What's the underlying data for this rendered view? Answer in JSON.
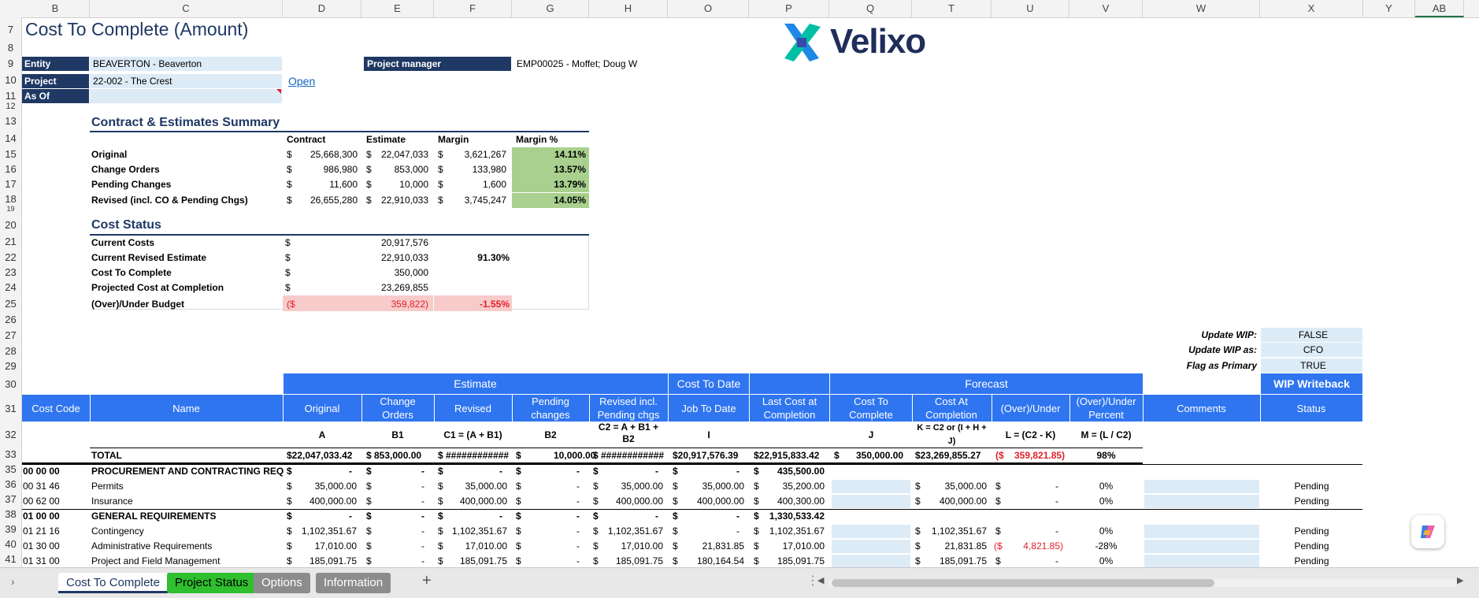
{
  "columns": [
    "B",
    "C",
    "D",
    "E",
    "F",
    "G",
    "H",
    "O",
    "P",
    "Q",
    "T",
    "U",
    "V",
    "W",
    "X",
    "Y",
    "AB"
  ],
  "rows": [
    "7",
    "8",
    "9",
    "10",
    "11",
    "12",
    "13",
    "14",
    "15",
    "16",
    "17",
    "18",
    "19",
    "20",
    "21",
    "22",
    "23",
    "24",
    "25",
    "26",
    "27",
    "28",
    "29",
    "30",
    "31",
    "32",
    "33",
    "35",
    "36",
    "37",
    "38",
    "39",
    "40",
    "41"
  ],
  "title": "Cost To Complete (Amount)",
  "logo_text": "Velixo",
  "header_fields": {
    "entity_label": "Entity",
    "entity_value": "BEAVERTON - Beaverton",
    "project_label": "Project",
    "project_value": "22-002 - The Crest",
    "asof_label": "As Of",
    "asof_value": "",
    "open_link": "Open",
    "pm_label": "Project manager",
    "pm_value": "EMP00025 - Moffet; Doug W"
  },
  "summary": {
    "title": "Contract & Estimates Summary",
    "headers": [
      "Contract",
      "Estimate",
      "Margin",
      "Margin %"
    ],
    "rows": [
      {
        "label": "Original",
        "contract": "25,668,300",
        "estimate": "22,047,033",
        "margin": "3,621,267",
        "pct": "14.11%"
      },
      {
        "label": "Change Orders",
        "contract": "986,980",
        "estimate": "853,000",
        "margin": "133,980",
        "pct": "13.57%"
      },
      {
        "label": "Pending Changes",
        "contract": "11,600",
        "estimate": "10,000",
        "margin": "1,600",
        "pct": "13.79%"
      },
      {
        "label": "Revised (incl. CO & Pending Chgs)",
        "contract": "26,655,280",
        "estimate": "22,910,033",
        "margin": "3,745,247",
        "pct": "14.05%"
      }
    ]
  },
  "cost_status": {
    "title": "Cost Status",
    "rows": [
      {
        "label": "Current Costs",
        "value": "20,917,576",
        "pct": ""
      },
      {
        "label": "Current Revised Estimate",
        "value": "22,910,033",
        "pct": "91.30%"
      },
      {
        "label": "Cost To Complete",
        "value": "350,000",
        "pct": ""
      },
      {
        "label": "Projected Cost at Completion",
        "value": "23,269,855",
        "pct": ""
      }
    ],
    "overunder_label": "(Over)/Under Budget",
    "overunder_value": "359,822)",
    "overunder_prefix": "($",
    "overunder_pct": "-1.55%"
  },
  "wip": {
    "update_label": "Update WIP:",
    "update_value": "FALSE",
    "as_label": "Update WIP as:",
    "as_value": "CFO",
    "primary_label": "Flag as Primary",
    "primary_value": "TRUE",
    "writeback": "WIP Writeback",
    "status": "Status"
  },
  "groups": {
    "estimate": "Estimate",
    "cost_to_date": "Cost To Date",
    "forecast": "Forecast"
  },
  "col_headers": {
    "cost_code": "Cost Code",
    "name": "Name",
    "original": "Original",
    "change_orders": "Change Orders",
    "revised": "Revised",
    "pending": "Pending changes",
    "revised_incl": "Revised incl. Pending chgs",
    "jtd": "Job To Date",
    "last_cost": "Last Cost at Completion",
    "ctc": "Cost To Complete",
    "cac": "Cost At Completion",
    "overunder": "(Over)/Under",
    "overunder_pct": "(Over)/Under Percent",
    "comments": "Comments"
  },
  "formulas": {
    "a": "A",
    "b1": "B1",
    "c1": "C1 = (A + B1)",
    "b2": "B2",
    "c2": "C2 = A + B1 + B2",
    "i": "I",
    "j": "J",
    "k": "K = C2 or (I + H + J)",
    "l": "L = (C2 - K)",
    "m": "M = (L / C2)"
  },
  "total": {
    "label": "TOTAL",
    "original": "$22,047,033.42",
    "change_orders": "$ 853,000.00",
    "revised": "$ ############",
    "pending": "$ 10,000.00",
    "revised_incl": "$ ############",
    "jtd": "$20,917,576.39",
    "last_cost": "$22,915,833.42",
    "ctc": "$ 350,000.00",
    "cac": "$23,269,855.27",
    "overunder": "($ 359,821.85)",
    "pct": "98%"
  },
  "lines": [
    {
      "code": "00 00 00",
      "name": "PROCUREMENT AND CONTRACTING REQ",
      "bold": true,
      "original": "-",
      "co": "-",
      "revised": "-",
      "pending": "-",
      "rincl": "-",
      "jtd": "-",
      "last": "435,500.00",
      "ctc": "",
      "cac": "",
      "ou": "",
      "pct": "",
      "status": ""
    },
    {
      "code": "00 31 46",
      "name": "Permits",
      "bold": false,
      "original": "35,000.00",
      "co": "-",
      "revised": "35,000.00",
      "pending": "-",
      "rincl": "35,000.00",
      "jtd": "35,000.00",
      "last": "35,200.00",
      "ctc": "",
      "cac": "35,000.00",
      "ou": "-",
      "pct": "0%",
      "status": "Pending"
    },
    {
      "code": "00 62 00",
      "name": "Insurance",
      "bold": false,
      "original": "400,000.00",
      "co": "-",
      "revised": "400,000.00",
      "pending": "-",
      "rincl": "400,000.00",
      "jtd": "400,000.00",
      "last": "400,300.00",
      "ctc": "",
      "cac": "400,000.00",
      "ou": "-",
      "pct": "0%",
      "status": "Pending"
    },
    {
      "code": "01 00 00",
      "name": "GENERAL REQUIREMENTS",
      "bold": true,
      "original": "-",
      "co": "-",
      "revised": "-",
      "pending": "-",
      "rincl": "-",
      "jtd": "-",
      "last": "1,330,533.42",
      "ctc": "",
      "cac": "",
      "ou": "",
      "pct": "",
      "status": ""
    },
    {
      "code": "01 21 16",
      "name": "Contingency",
      "bold": false,
      "original": "1,102,351.67",
      "co": "-",
      "revised": "1,102,351.67",
      "pending": "-",
      "rincl": "1,102,351.67",
      "jtd": "-",
      "last": "1,102,351.67",
      "ctc": "",
      "cac": "1,102,351.67",
      "ou": "-",
      "pct": "0%",
      "status": "Pending"
    },
    {
      "code": "01 30 00",
      "name": "Administrative Requirements",
      "bold": false,
      "original": "17,010.00",
      "co": "-",
      "revised": "17,010.00",
      "pending": "-",
      "rincl": "17,010.00",
      "jtd": "21,831.85",
      "last": "17,010.00",
      "ctc": "",
      "cac": "21,831.85",
      "ou": "4,821.85)",
      "pct": "-28%",
      "status": "Pending"
    },
    {
      "code": "01 31 00",
      "name": "Project and Field Management",
      "bold": false,
      "original": "185,091.75",
      "co": "-",
      "revised": "185,091.75",
      "pending": "-",
      "rincl": "185,091.75",
      "jtd": "180,164.54",
      "last": "185,091.75",
      "ctc": "",
      "cac": "185,091.75",
      "ou": "-",
      "pct": "0%",
      "status": "Pending"
    }
  ],
  "tabs": [
    "Cost To Complete",
    "Project Status",
    "Options",
    "Information"
  ],
  "colors": {
    "navy": "#1f3864",
    "blue": "#2f75f0",
    "green": "#a9d08e",
    "pink": "#f8cbcb",
    "light": "#ddebf7"
  }
}
